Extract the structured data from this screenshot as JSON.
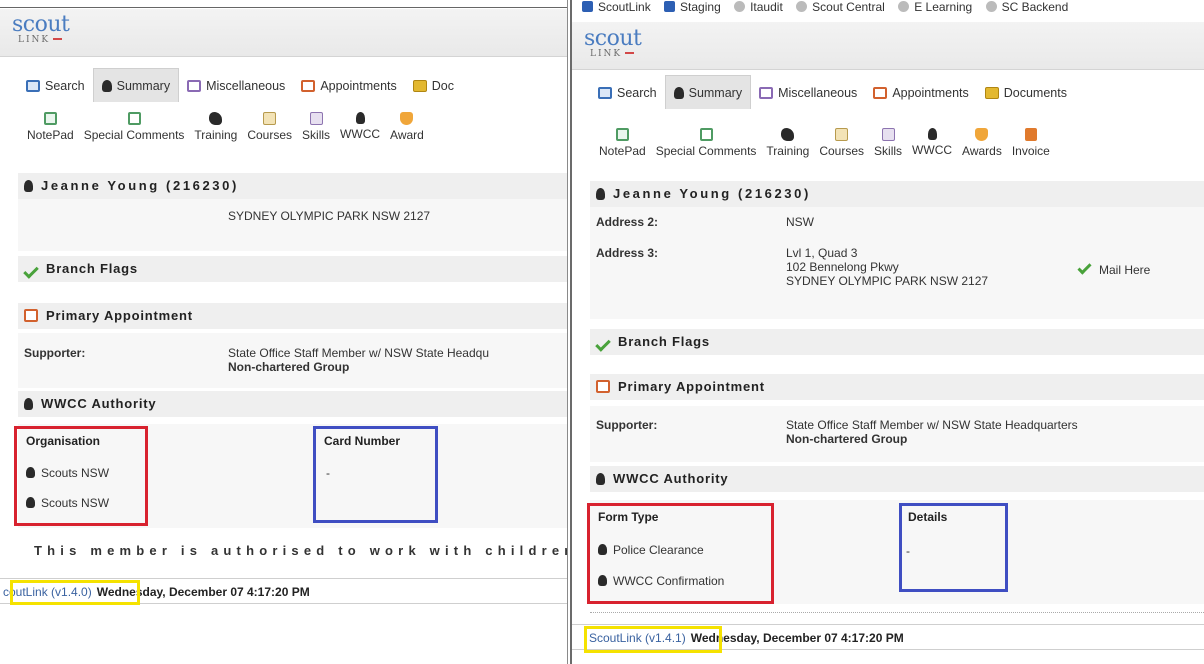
{
  "logo": {
    "text": "scout",
    "sub": "LINK"
  },
  "bookmarks": [
    "ScoutLink",
    "Staging",
    "Itaudit",
    "Scout Central",
    "E Learning",
    "SC Backend"
  ],
  "tabs": [
    "Search",
    "Summary",
    "Miscellaneous",
    "Appointments",
    "Documents"
  ],
  "tabs_left_last": "Doc",
  "toolbar": [
    "NotePad",
    "Special Comments",
    "Training",
    "Courses",
    "Skills",
    "WWCC",
    "Awards",
    "Invoice"
  ],
  "toolbar_left_last": "Award",
  "member": {
    "name": "Jeanne Young (216230)"
  },
  "address": {
    "address2_label": "Address 2:",
    "address2_value": "NSW",
    "address3_label": "Address 3:",
    "line1": "Lvl 1, Quad 3",
    "line2": "102 Bennelong Pkwy",
    "line3": "SYDNEY OLYMPIC PARK NSW 2127",
    "mail_here": "Mail Here"
  },
  "sections": {
    "branch_flags": "Branch Flags",
    "primary_appointment": "Primary Appointment",
    "wwcc_authority": "WWCC Authority"
  },
  "appointment": {
    "label": "Supporter:",
    "value": "State Office Staff Member w/ NSW State Headquarters",
    "value_left": "State Office Staff Member w/ NSW State Headqu",
    "group": "Non-chartered Group"
  },
  "left_table": {
    "col1": "Organisation",
    "col2": "Card Number",
    "rows": [
      "Scouts NSW",
      "Scouts NSW"
    ],
    "card": "-"
  },
  "right_table": {
    "col1": "Form Type",
    "col2": "Details",
    "rows": [
      "Police Clearance",
      "WWCC Confirmation"
    ],
    "detail": "-"
  },
  "authorised_text": "This member is authorised to work with children",
  "footer": {
    "left_version": "coutLink (v1.4.0)",
    "right_version": "ScoutLink (v1.4.1)",
    "date": "Wednesday, December 07 4:17:20 PM"
  },
  "colors": {
    "annotation_red": "#d8222f",
    "annotation_blue": "#3f4ec2",
    "annotation_yellow": "#f5e200",
    "logo_blue": "#4a7cc0"
  }
}
